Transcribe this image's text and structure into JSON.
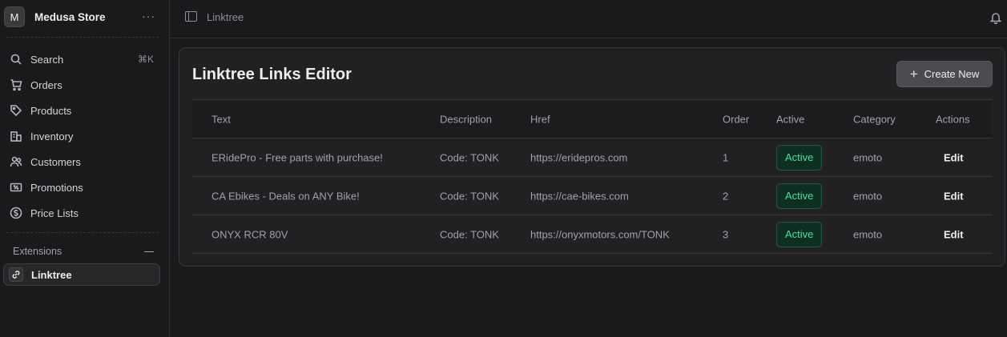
{
  "sidebar": {
    "store_initial": "M",
    "store_name": "Medusa Store",
    "more": "···",
    "items": [
      {
        "label": "Search",
        "icon": "search-icon",
        "shortcut": "⌘K"
      },
      {
        "label": "Orders",
        "icon": "cart-icon"
      },
      {
        "label": "Products",
        "icon": "tag-icon"
      },
      {
        "label": "Inventory",
        "icon": "building-icon"
      },
      {
        "label": "Customers",
        "icon": "users-icon"
      },
      {
        "label": "Promotions",
        "icon": "receipt-percent-icon"
      },
      {
        "label": "Price Lists",
        "icon": "currency-icon"
      }
    ],
    "extensions_label": "Extensions",
    "active_item": {
      "label": "Linktree",
      "icon": "link-icon"
    }
  },
  "topbar": {
    "breadcrumb": "Linktree"
  },
  "page": {
    "title": "Linktree Links Editor",
    "create_label": "Create New"
  },
  "table": {
    "headers": [
      "Text",
      "Description",
      "Href",
      "Order",
      "Active",
      "Category",
      "Actions"
    ],
    "rows": [
      {
        "text": "ERidePro - Free parts with purchase!",
        "description": "Code: TONK",
        "href": "https://eridepros.com",
        "order": "1",
        "active": "Active",
        "category": "emoto",
        "action": "Edit"
      },
      {
        "text": "CA Ebikes - Deals on ANY Bike!",
        "description": "Code: TONK",
        "href": "https://cae-bikes.com",
        "order": "2",
        "active": "Active",
        "category": "emoto",
        "action": "Edit"
      },
      {
        "text": "ONYX RCR 80V",
        "description": "Code: TONK",
        "href": "https://onyxmotors.com/TONK",
        "order": "3",
        "active": "Active",
        "category": "emoto",
        "action": "Edit"
      }
    ]
  },
  "colors": {
    "background": "#1a1a1c",
    "card": "#212124",
    "active_badge_bg": "#0f2e22",
    "active_badge_text": "#3ee79a",
    "button_bg": "#4a4a4f"
  }
}
